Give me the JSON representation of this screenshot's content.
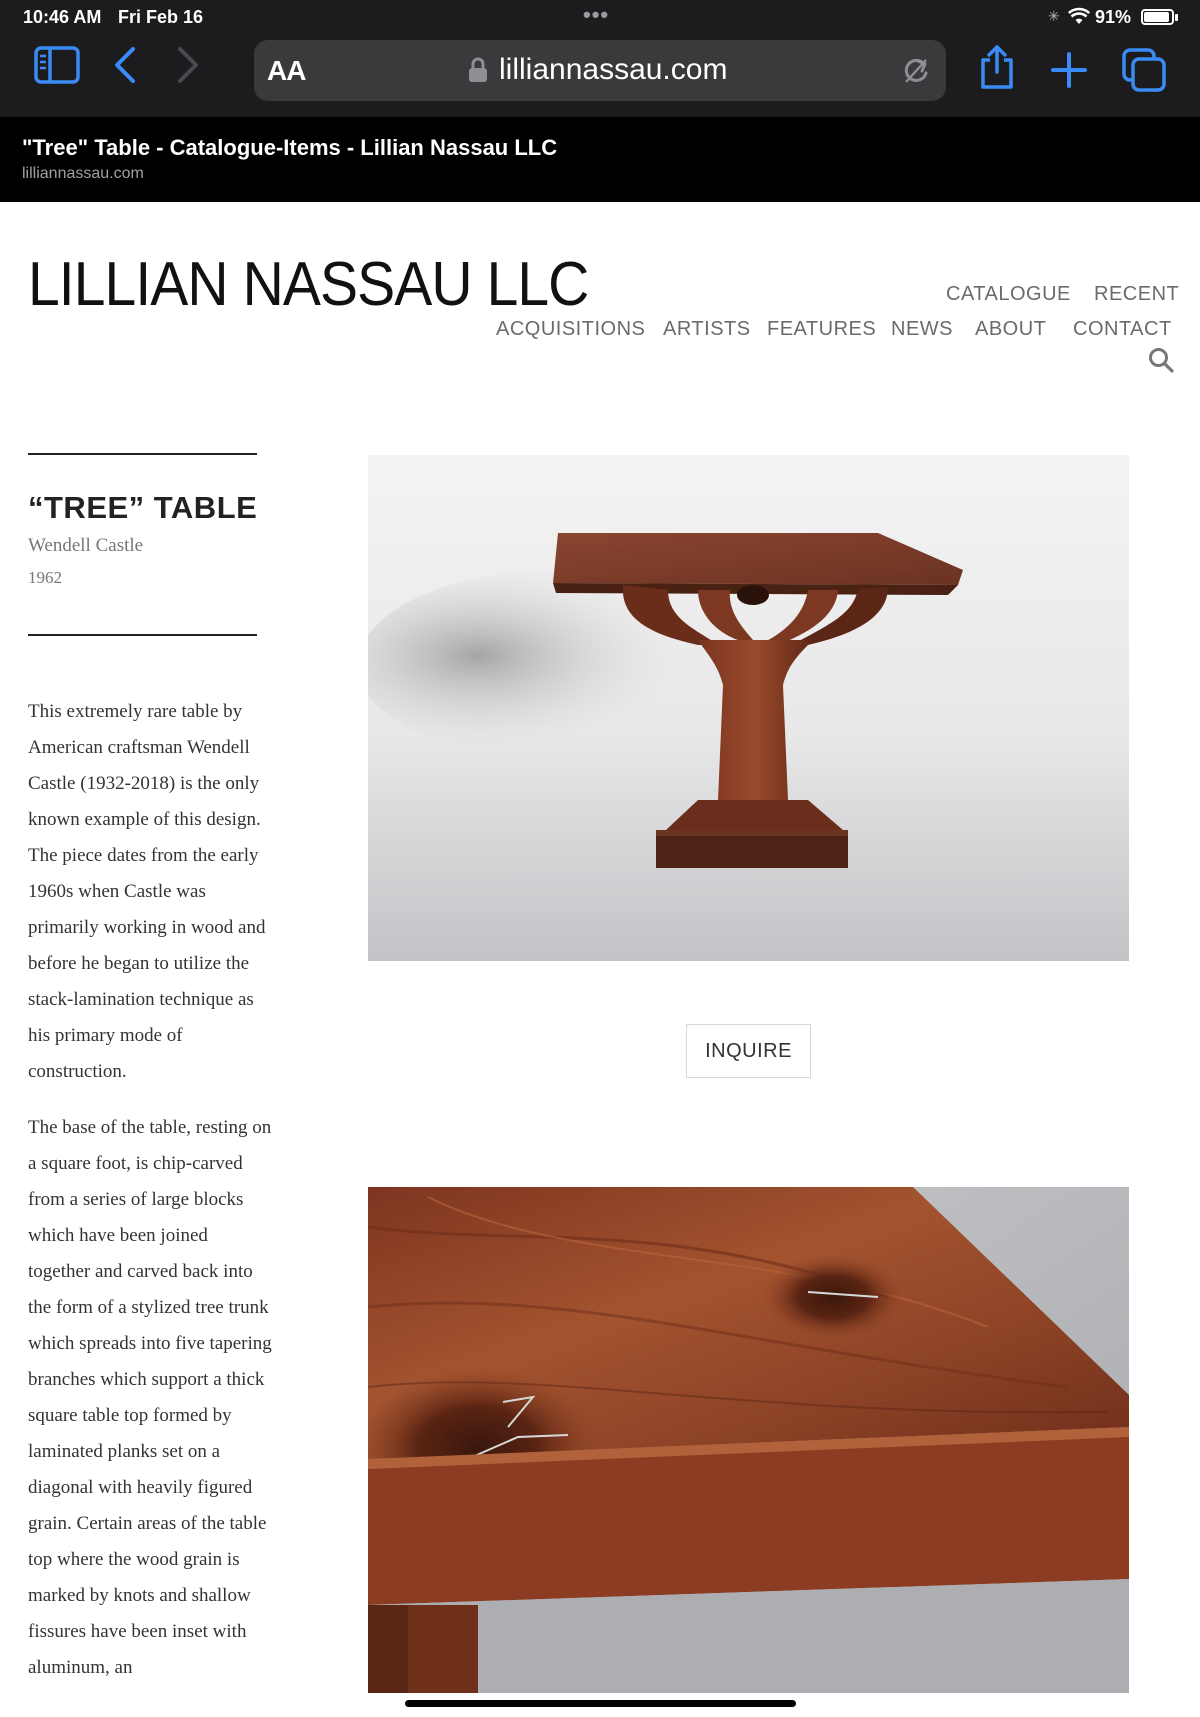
{
  "status_bar": {
    "time": "10:46 AM",
    "date": "Fri Feb 16",
    "battery_percent": "91%",
    "battery_level": 0.91
  },
  "browser": {
    "aa_label": "AA",
    "url_host": "lilliannassau.com",
    "tab_title": "\"Tree\" Table - Catalogue-Items - Lillian Nassau LLC",
    "tab_host": "lilliannassau.com",
    "accent_color": "#3a8bf5"
  },
  "site": {
    "logo": "LILLIAN NASSAU LLC",
    "nav": {
      "catalogue": "CATALOGUE",
      "recent": "RECENT",
      "acquisitions": "ACQUISITIONS",
      "artists": "ARTISTS",
      "features": "FEATURES",
      "news": "NEWS",
      "about": "ABOUT",
      "contact": "CONTACT"
    }
  },
  "item": {
    "title": "“TREE” TABLE",
    "artist": "Wendell Castle",
    "year": "1962",
    "paragraphs": [
      "This extremely rare table by American craftsman Wendell Castle (1932-2018)  is the only known example of this design. The piece dates from the early 1960s when Castle was primarily working in wood and before he began to utilize the stack-lamination technique as his primary mode of construction.",
      "The base of the table, resting on a square foot, is chip-carved from a series of large blocks which have been joined together and carved back into the form of a stylized tree trunk which spreads into five tapering branches which support a thick square table top formed by laminated planks set on a diagonal with heavily figured grain. Certain areas of the table top where the wood grain is marked by knots and shallow fissures have been inset with aluminum, an"
    ],
    "inquire_label": "INQUIRE"
  }
}
